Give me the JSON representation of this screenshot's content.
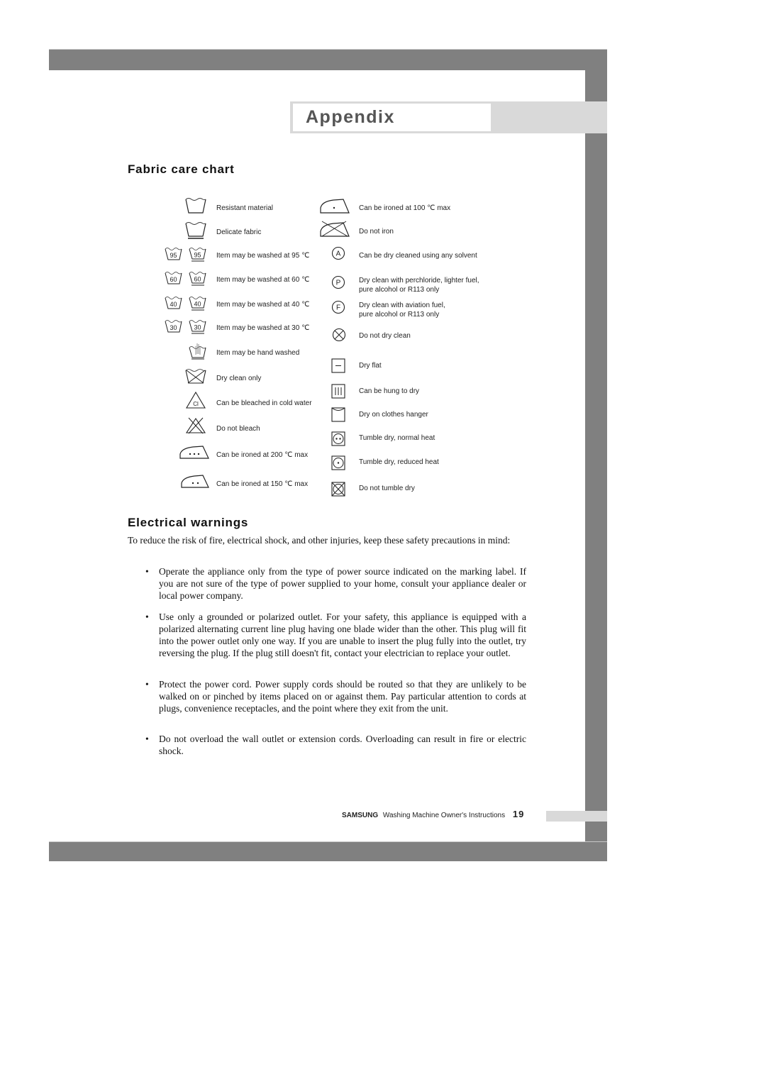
{
  "header": {
    "title": "Appendix"
  },
  "fabric_care": {
    "heading": "Fabric care chart",
    "left_items": [
      {
        "icon": "wash-tub-icon",
        "label": "Resistant material"
      },
      {
        "icon": "wash-tub-delicate-icon",
        "label": "Delicate fabric"
      },
      {
        "icon": "wash-95-icon",
        "temp": "95",
        "label": "Item may be washed at 95 ℃"
      },
      {
        "icon": "wash-60-icon",
        "temp": "60",
        "label": "Item may be washed at 60 ℃"
      },
      {
        "icon": "wash-40-icon",
        "temp": "40",
        "label": "Item may be washed at 40 ℃"
      },
      {
        "icon": "wash-30-icon",
        "temp": "30",
        "label": "Item may be washed at 30 ℃"
      },
      {
        "icon": "hand-wash-icon",
        "label": "Item may be hand washed"
      },
      {
        "icon": "dry-clean-only-icon",
        "label": "Dry clean only"
      },
      {
        "icon": "bleach-cold-icon",
        "symbol": "Cl",
        "label": "Can be bleached in cold water"
      },
      {
        "icon": "do-not-bleach-icon",
        "label": "Do not bleach"
      },
      {
        "icon": "iron-200-icon",
        "label": "Can be ironed at 200 ℃ max"
      },
      {
        "icon": "iron-150-icon",
        "label": "Can be ironed at 150 ℃ max"
      }
    ],
    "right_items": [
      {
        "icon": "iron-100-icon",
        "label": "Can be ironed at 100 ℃  max"
      },
      {
        "icon": "do-not-iron-icon",
        "label": "Do not iron"
      },
      {
        "icon": "dry-clean-a-icon",
        "symbol": "A",
        "label": "Can be dry cleaned using any solvent"
      },
      {
        "icon": "dry-clean-p-icon",
        "symbol": "P",
        "label": "Dry clean with perchloride, lighter fuel,",
        "label2": "pure alcohol or R113 only"
      },
      {
        "icon": "dry-clean-f-icon",
        "symbol": "F",
        "label": "Dry clean with aviation fuel,",
        "label2": "pure alcohol or R113 only"
      },
      {
        "icon": "do-not-dry-clean-icon",
        "label": "Do not dry clean"
      },
      {
        "icon": "dry-flat-icon",
        "label": "Dry flat"
      },
      {
        "icon": "hang-dry-icon",
        "label": "Can be hung to dry"
      },
      {
        "icon": "clothes-hanger-icon",
        "label": "Dry on clothes hanger"
      },
      {
        "icon": "tumble-normal-icon",
        "label": " Tumble dry, normal heat"
      },
      {
        "icon": "tumble-reduced-icon",
        "label": "Tumble dry, reduced heat"
      },
      {
        "icon": "do-not-tumble-icon",
        "label": "Do not tumble dry"
      }
    ]
  },
  "electrical": {
    "heading": "Electrical warnings",
    "intro": "To reduce the risk of fire, electrical shock, and other injuries, keep these safety precautions in mind:",
    "bullet_char": "•",
    "bullets": [
      "Operate the appliance only from the type of power source indicated on the marking label.  If you are not sure of the type of power supplied to your home, consult your appliance dealer or local power company.",
      "Use only a grounded or polarized outlet.  For your safety, this appliance is equipped with a polarized alternating current line plug having one blade wider than the other. This plug will fit into the power outlet only one way.  If you are unable to insert the plug fully into the outlet, try reversing the plug.  If the plug still doesn't fit, contact your electrician to replace your outlet.",
      "Protect the power cord. Power supply cords should be routed so that they are unlikely to be walked on or pinched by items placed on or against them.  Pay particular attention to cords at plugs, convenience receptacles, and the point where they exit from the unit.",
      "Do not overload the wall outlet or extension cords.  Overloading can result in fire or electric shock."
    ]
  },
  "footer": {
    "brand": "SAMSUNG",
    "title": "Washing Machine Owner's Instructions",
    "page_number": "19"
  }
}
